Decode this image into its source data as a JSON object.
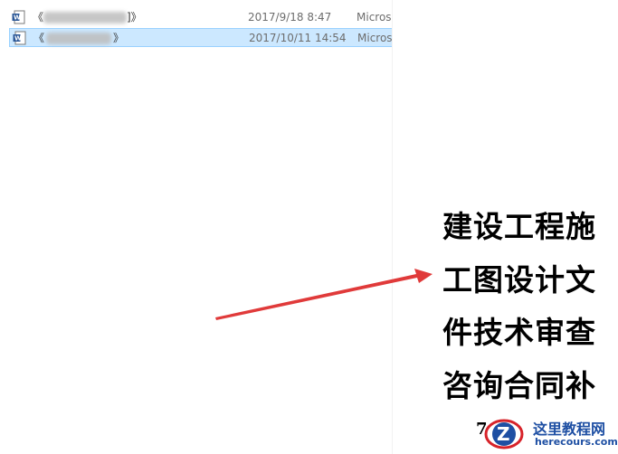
{
  "files": [
    {
      "name_prefix": "《",
      "name_suffix": "]》",
      "date": "2017/9/18 8:47",
      "type": "Micros",
      "selected": false
    },
    {
      "name_prefix": "《",
      "name_suffix": "》",
      "date": "2017/10/11 14:54",
      "type": "Micros",
      "selected": true
    }
  ],
  "caption": {
    "lines": [
      "建设工程施",
      "工图设计文",
      "件技术审查",
      "咨询合同补"
    ]
  },
  "stray_char": "7",
  "watermark": {
    "name": "这里教程网",
    "url": "herecours.com"
  },
  "colors": {
    "arrow": "#e03a3a",
    "selection": "#cce8ff",
    "watermark_blue": "#1e4fa3",
    "watermark_red": "#d7232a"
  },
  "icons": {
    "file": "word-document-icon",
    "logo": "z-logo-icon"
  }
}
